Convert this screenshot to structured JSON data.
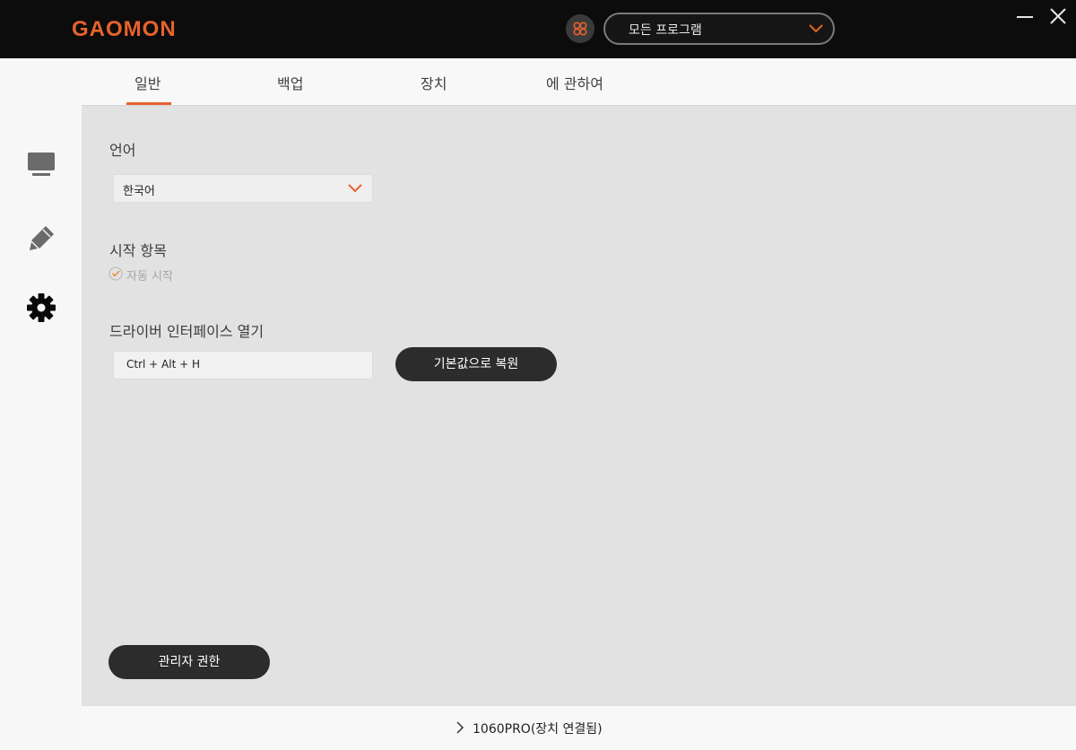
{
  "app": {
    "logo_text": "GAOMON",
    "brand_color": "#e8622c"
  },
  "header": {
    "program_select_value": "모든 프로그램"
  },
  "tabs": [
    {
      "label": "일반",
      "active": true
    },
    {
      "label": "백업",
      "active": false
    },
    {
      "label": "장치",
      "active": false
    },
    {
      "label": "에 관하여",
      "active": false
    }
  ],
  "sidebar": {
    "items": [
      {
        "icon": "monitor-icon"
      },
      {
        "icon": "pen-icon"
      },
      {
        "icon": "gear-icon",
        "active": true
      }
    ]
  },
  "general": {
    "language_label": "언어",
    "language_value": "한국어",
    "startup_label": "시작 항목",
    "autostart_label": "자동 시작",
    "autostart_checked": true,
    "driver_label": "드라이버 인터페이스 열기",
    "hotkey_value": "Ctrl + Alt + H",
    "restore_button": "기본값으로 복원",
    "admin_button": "관리자 권한"
  },
  "status": {
    "device_text": "1060PRO(장치 연결됨)"
  }
}
